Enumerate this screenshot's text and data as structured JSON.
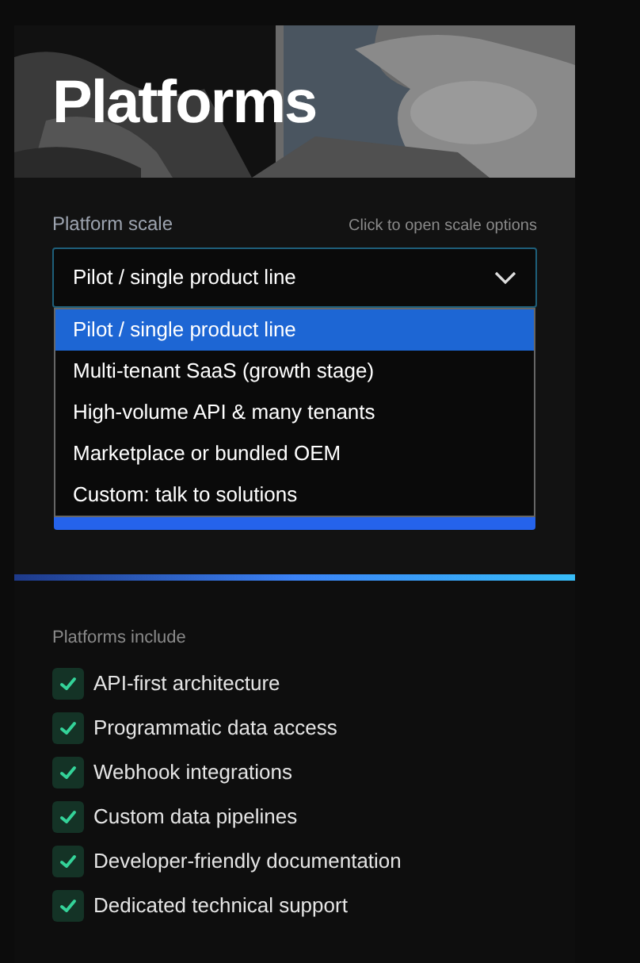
{
  "hero": {
    "title": "Platforms",
    "kind": "picture"
  },
  "scale": {
    "label": "Platform scale",
    "hint": "Click to open scale options",
    "value": "Pilot / single product line",
    "expanded": true,
    "options": [
      {
        "label": "Pilot / single product line",
        "selected": true
      },
      {
        "label": "Multi-tenant SaaS (growth stage)",
        "selected": false
      },
      {
        "label": "High-volume API & many tenants",
        "selected": false
      },
      {
        "label": "Marketplace or bundled OEM",
        "selected": false
      },
      {
        "label": "Custom: talk to solutions",
        "selected": false
      }
    ]
  },
  "features": {
    "heading": "Platforms include",
    "items": [
      {
        "label": "API-first architecture",
        "checked": true
      },
      {
        "label": "Programmatic data access",
        "checked": true
      },
      {
        "label": "Webhook integrations",
        "checked": true
      },
      {
        "label": "Custom data pipelines",
        "checked": true
      },
      {
        "label": "Developer-friendly documentation",
        "checked": true
      },
      {
        "label": "Dedicated technical support",
        "checked": true
      }
    ]
  }
}
